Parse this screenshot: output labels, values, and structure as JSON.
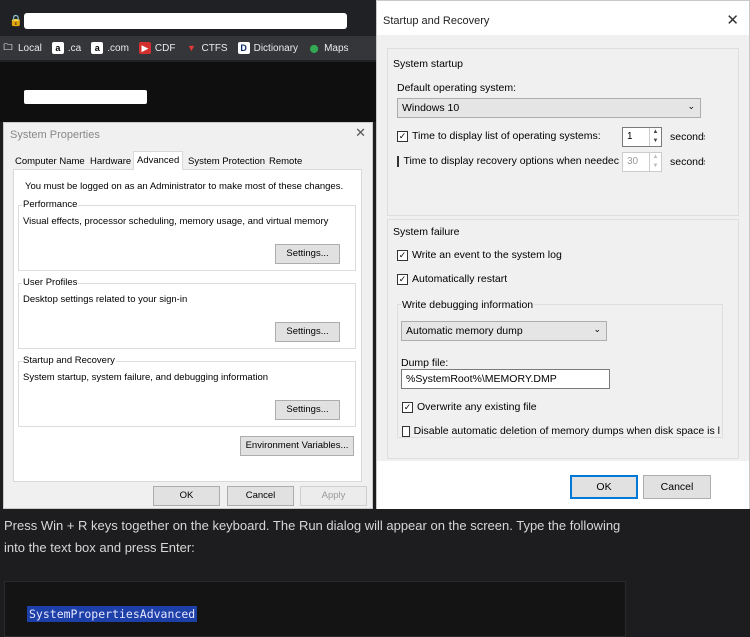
{
  "browser": {
    "bookmarks": [
      {
        "label": "Local",
        "icon": "folder-icon"
      },
      {
        "label": ".ca",
        "icon": "amazon-icon"
      },
      {
        "label": ".com",
        "icon": "amazon-icon"
      },
      {
        "label": "CDF",
        "icon": "cdf-icon"
      },
      {
        "label": "CTFS",
        "icon": "ctfs-icon"
      },
      {
        "label": "Dictionary",
        "icon": "dictionary-icon"
      },
      {
        "label": "Maps",
        "icon": "maps-pin-icon"
      }
    ],
    "amazon_glyph": "a",
    "dict_glyph": "D",
    "folder_glyph": "🗀",
    "ctfs_glyph": "▼",
    "maps_glyph": "⬤",
    "cdf_glyph": "▶"
  },
  "system_properties": {
    "title": "System Properties",
    "tabs": [
      "Computer Name",
      "Hardware",
      "Advanced",
      "System Protection",
      "Remote"
    ],
    "admin_notice": "You must be logged on as an Administrator to make most of these changes.",
    "performance": {
      "label": "Performance",
      "desc": "Visual effects, processor scheduling, memory usage, and virtual memory",
      "button": "Settings..."
    },
    "user_profiles": {
      "label": "User Profiles",
      "desc": "Desktop settings related to your sign-in",
      "button": "Settings..."
    },
    "startup_recovery": {
      "label": "Startup and Recovery",
      "desc": "System startup, system failure, and debugging information",
      "button": "Settings..."
    },
    "env_button": "Environment Variables...",
    "ok": "OK",
    "cancel": "Cancel",
    "apply": "Apply"
  },
  "startup_recovery": {
    "title": "Startup and Recovery",
    "system_startup": {
      "label": "System startup",
      "default_os_label": "Default operating system:",
      "default_os_value": "Windows 10",
      "time_list_label": "Time to display list of operating systems:",
      "time_list_checked": true,
      "time_list_value": "1",
      "time_recovery_label": "Time to display recovery options when needec",
      "time_recovery_checked": false,
      "time_recovery_value": "30",
      "seconds": "seconds"
    },
    "system_failure": {
      "label": "System failure",
      "write_event": "Write an event to the system log",
      "write_event_checked": true,
      "auto_restart": "Automatically restart",
      "auto_restart_checked": true,
      "debug_label": "Write debugging information",
      "debug_value": "Automatic memory dump",
      "dump_file_label": "Dump file:",
      "dump_file_value": "%SystemRoot%\\MEMORY.DMP",
      "overwrite": "Overwrite any existing file",
      "overwrite_checked": true,
      "disable_auto_delete": "Disable automatic deletion of memory dumps when disk space is l",
      "disable_auto_delete_checked": false
    },
    "ok": "OK",
    "cancel": "Cancel"
  },
  "page": {
    "paragraph": "Press Win + R keys together on the keyboard. The Run dialog will appear on the screen. Type the following into the text box and press Enter:",
    "code": "SystemPropertiesAdvanced"
  },
  "colors": {
    "code_highlight": "#1d3fa8",
    "page_bg": "#1d1d1f"
  }
}
